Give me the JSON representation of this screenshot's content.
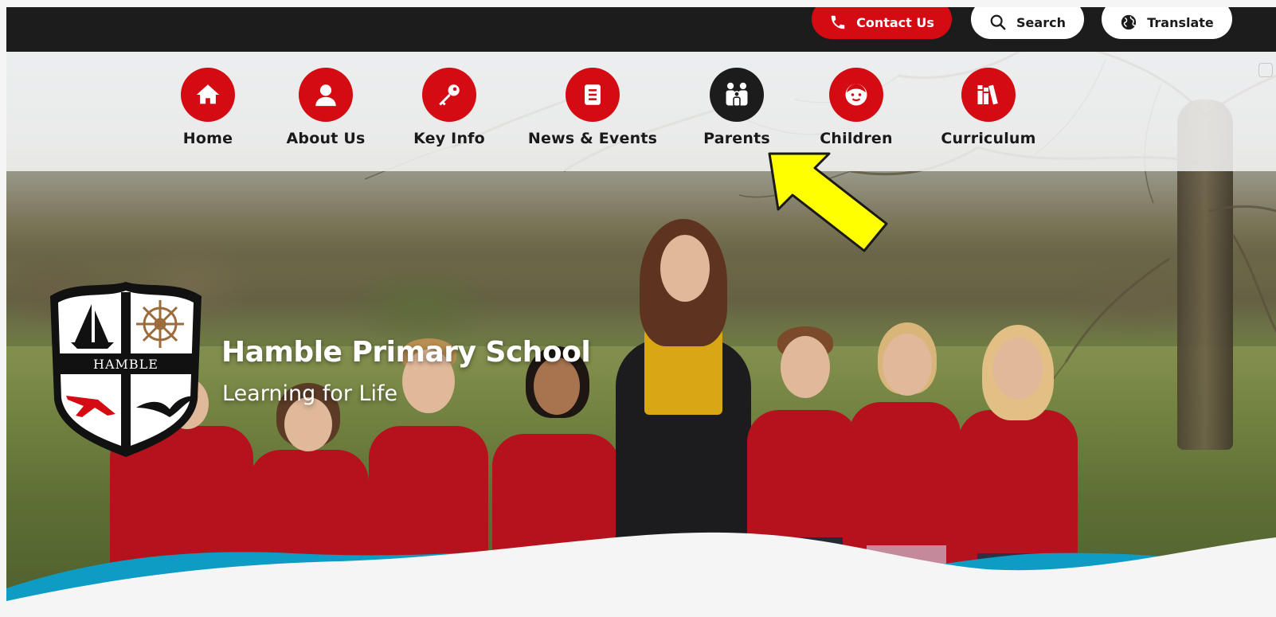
{
  "topbar": {
    "contact_label": "Contact Us",
    "search_label": "Search",
    "translate_label": "Translate"
  },
  "nav": {
    "items": [
      {
        "label": "Home",
        "icon": "home-icon"
      },
      {
        "label": "About Us",
        "icon": "user-icon"
      },
      {
        "label": "Key Info",
        "icon": "key-icon"
      },
      {
        "label": "News & Events",
        "icon": "document-icon"
      },
      {
        "label": "Parents",
        "icon": "family-icon",
        "active": true
      },
      {
        "label": "Children",
        "icon": "child-face-icon"
      },
      {
        "label": "Curriculum",
        "icon": "books-icon"
      }
    ]
  },
  "brand": {
    "crest_text": "HAMBLE",
    "school_name": "Hamble Primary School",
    "tagline": "Learning for Life"
  },
  "colors": {
    "brand_red": "#d40b13",
    "topbar_dark": "#1c1c1c",
    "active_nav": "#1c1c1c",
    "wave_blue": "#0e9cc4",
    "annotation_arrow": "#ffff00"
  }
}
